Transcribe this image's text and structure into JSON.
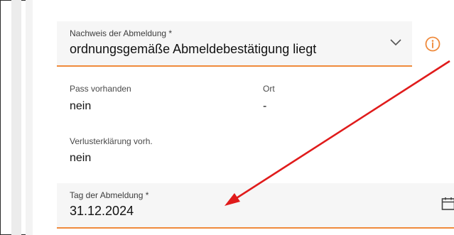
{
  "form": {
    "proof_field": {
      "label": "Nachweis der Abmeldung *",
      "value": "ordnungsgemäße Abmeldebestätigung liegt"
    },
    "passport": {
      "label": "Pass vorhanden",
      "value": "nein"
    },
    "place": {
      "label": "Ort",
      "value": "-"
    },
    "loss_declaration": {
      "label": "Verlusterklärung vorh.",
      "value": "nein"
    },
    "deregistration_date": {
      "label": "Tag der Abmeldung *",
      "value": "31.12.2024"
    }
  },
  "icons": {
    "dropdown": "chevron-down-icon",
    "info": "info-icon",
    "calendar": "calendar-icon",
    "annotation": "red-arrow"
  },
  "colors": {
    "accent": "#ef8a3c",
    "annotation_arrow": "#e01b1b",
    "field_bg": "#f6f6f6"
  }
}
